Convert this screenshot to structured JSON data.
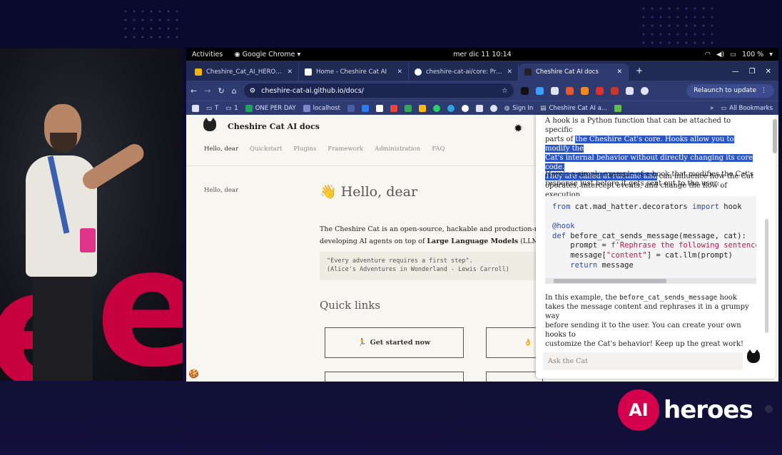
{
  "gnome": {
    "activities": "Activities",
    "app": "Google Chrome",
    "clock": "mer dic 11  10:14",
    "battery": "100 %"
  },
  "tabs": [
    {
      "label": "Cheshire_Cat_AI_HEROES - I",
      "color": "#f4b400"
    },
    {
      "label": "Home - Cheshire Cat AI",
      "color": "#ffffff"
    },
    {
      "label": "cheshire-cat-ai/core: Produc",
      "color": "#ffffff"
    },
    {
      "label": "Cheshire Cat AI docs",
      "color": "#ffffff"
    }
  ],
  "address": {
    "url": "cheshire-cat-ai.github.io/docs/",
    "relaunch": "Relaunch to update"
  },
  "bookmarks": {
    "items": [
      "T",
      "1",
      "ONE PER DAY",
      "localhost"
    ],
    "signin": "Sign In",
    "cat": "Cheshire Cat AI a...",
    "all": "All Bookmarks"
  },
  "docs": {
    "site_title": "Cheshire Cat AI docs",
    "nav": [
      "Hello, dear",
      "Quickstart",
      "Plugins",
      "Framework",
      "Administration",
      "FAQ"
    ],
    "side_item": "Hello, dear",
    "heading": "Hello, dear",
    "heading_emoji": "👋",
    "intro_line1": "The Cheshire Cat is an open-source, hackable and production-read",
    "intro_line2_pre": "developing AI agents on top of ",
    "intro_line2_bold": "Large Language Models",
    "intro_line2_post": " (LLM).",
    "quote_line1": "\"Every adventure requires a first step\".",
    "quote_line2": "(Alice's Adventures in Wonderland - Lewis Carroll)",
    "quick_links": "Quick links",
    "get_started": "Get started now",
    "get_started_emoji": "🏃"
  },
  "chat": {
    "p1_a": "A hook is a Python function that can be attached to specific",
    "p1_b_pre": "parts of ",
    "p1_b_hl": "the Cheshire Cat's core. Hooks allow you to modify the",
    "p1_c_hl": "Cat's internal behavior without directly changing its core code.",
    "p1_d_hl": "They are called at runtime and",
    "p1_d_post": " can influence how the Cat",
    "p1_e": "operates, intercept events, and change the flow of execution.",
    "p2_a": "Here's a simple example of a hook that modifies the Cat's",
    "p2_b": "response just before it gets sent out to the user:",
    "code": {
      "l1_kw1": "from",
      "l1_mod": " cat.mad_hatter.decorators ",
      "l1_kw2": "import",
      "l1_name": " hook",
      "l3": "@hook",
      "l4_kw": "def",
      "l4_rest": " before_cat_sends_message(message, cat):",
      "l5_pre": "    prompt = ",
      "l5_str": "f'Rephrase the following sentence",
      "l6_pre": "    message[",
      "l6_str": "\"content\"",
      "l6_post": "] = cat.llm(prompt)",
      "l7_kw": "    return",
      "l7_rest": " message"
    },
    "p3_a_pre": "In this example, the ",
    "p3_a_code": "before_cat_sends_message",
    "p3_a_post": " hook",
    "p3_b": "takes the message content and rephrases it in a grumpy way",
    "p3_c": "before sending it to the user. You can create your own hooks to",
    "p3_d": "customize the Cat's behavior! Keep up the great work!",
    "input_placeholder": "Ask the Cat"
  },
  "logo": {
    "ai": "AI",
    "word": "heroes"
  }
}
